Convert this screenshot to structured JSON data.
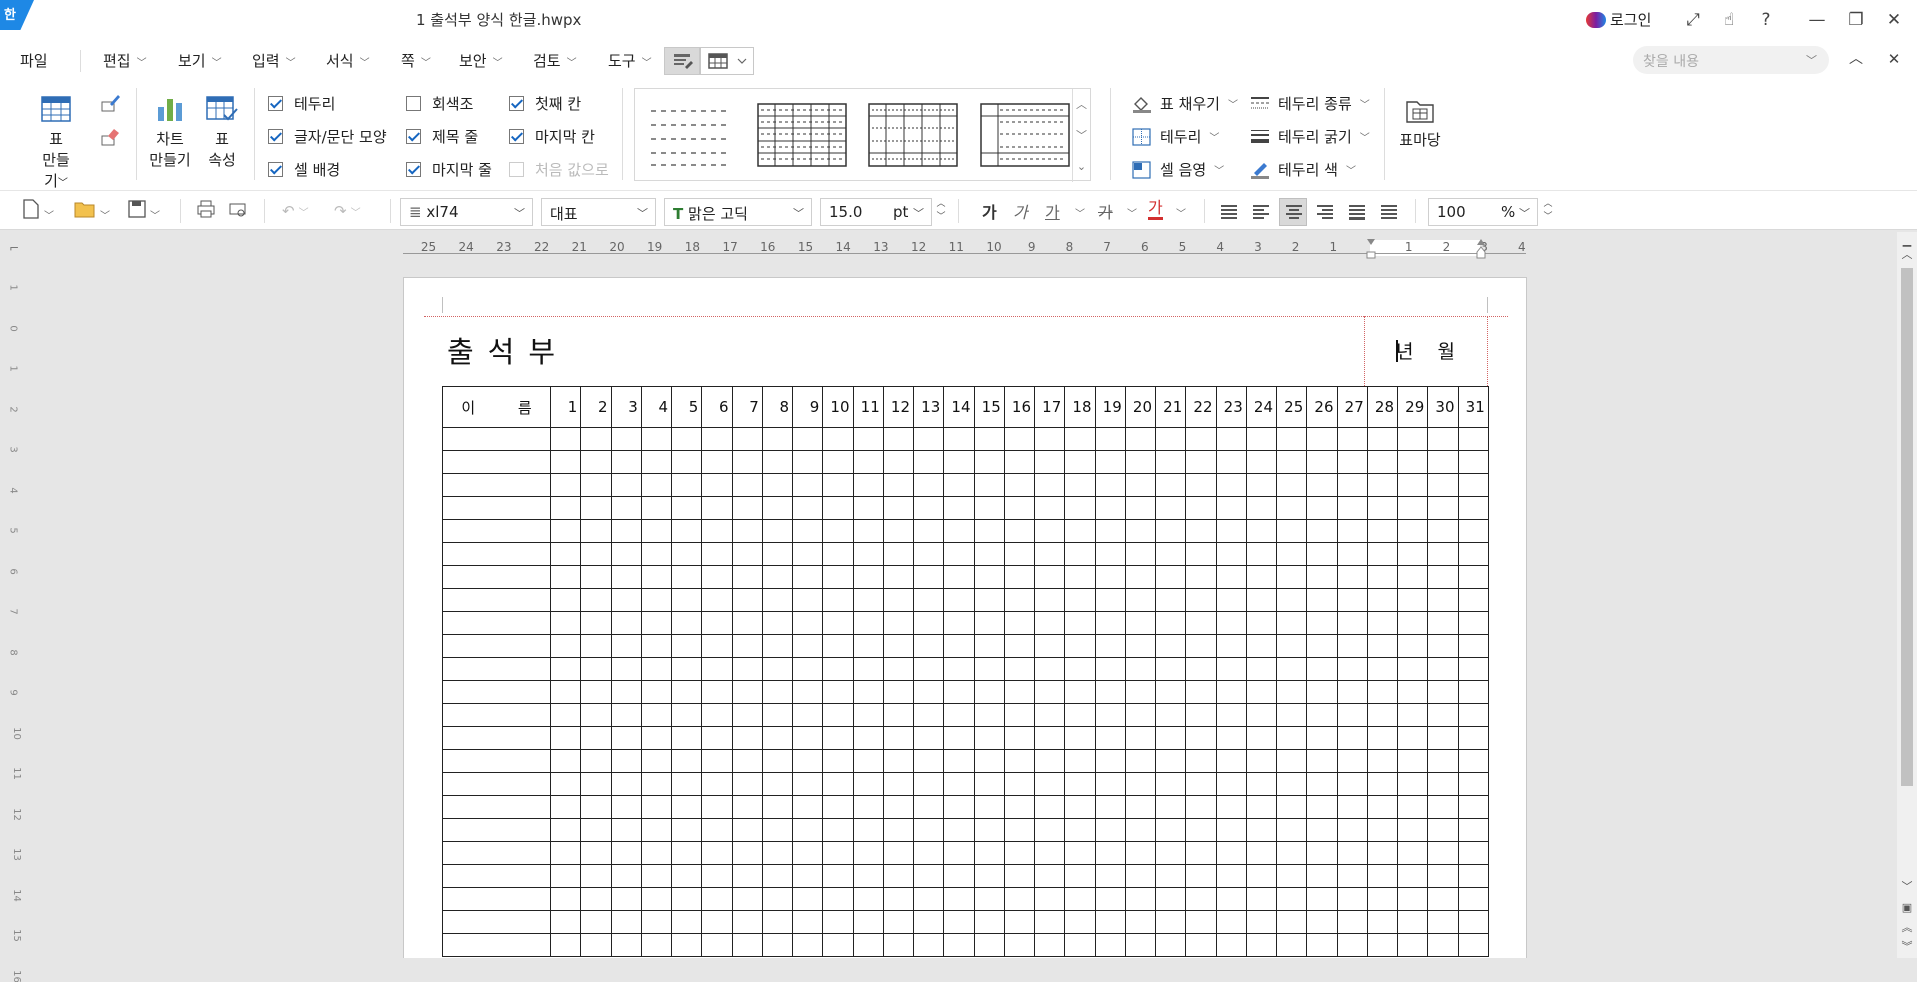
{
  "window": {
    "app_logo": "한",
    "title": "1 출석부 양식 한글.hwpx",
    "login_label": "로그인",
    "help_glyph": "?"
  },
  "menu": {
    "file": "파일",
    "items": [
      "편집",
      "보기",
      "입력",
      "서식",
      "쪽",
      "보안",
      "검토",
      "도구"
    ],
    "search_placeholder": "찾을 내용"
  },
  "ribbon": {
    "make_table": [
      "표",
      "만들기"
    ],
    "make_chart": [
      "차트",
      "만들기"
    ],
    "table_props": [
      "표",
      "속성"
    ],
    "checks": [
      {
        "label": "테두리",
        "checked": true,
        "enabled": true
      },
      {
        "label": "글자/문단 모양",
        "checked": true,
        "enabled": true
      },
      {
        "label": "셀 배경",
        "checked": true,
        "enabled": true
      },
      {
        "label": "회색조",
        "checked": false,
        "enabled": true
      },
      {
        "label": "제목 줄",
        "checked": true,
        "enabled": true
      },
      {
        "label": "마지막 줄",
        "checked": true,
        "enabled": true
      },
      {
        "label": "첫째 칸",
        "checked": true,
        "enabled": true
      },
      {
        "label": "마지막 칸",
        "checked": true,
        "enabled": true
      },
      {
        "label": "처음 값으로",
        "checked": false,
        "enabled": false
      }
    ],
    "fill": "표 채우기",
    "border": "테두리",
    "cell_shade": "셀 음영",
    "border_type": "테두리 종류",
    "border_width": "테두리 굵기",
    "border_color": "테두리 색",
    "table_madang": "표마당"
  },
  "toolbar": {
    "style_name": "xl74",
    "outline": "대표",
    "font": "맑은 고딕",
    "font_size": "15.0",
    "size_unit": "pt",
    "bold_glyph": "가",
    "italic_glyph": "가",
    "underline_glyph": "가",
    "strike_glyph": "가",
    "color_glyph": "가",
    "zoom": "100",
    "zoom_unit": "%",
    "accent_color": "#d32f2f"
  },
  "ruler": {
    "left_ticks": [
      "25",
      "24",
      "23",
      "22",
      "21",
      "20",
      "19",
      "18",
      "17",
      "16",
      "15",
      "14",
      "13",
      "12",
      "11",
      "10",
      "9",
      "8",
      "7",
      "6",
      "5",
      "4",
      "3",
      "2",
      "1"
    ],
    "right_ticks": [
      "1",
      "2",
      "3",
      "4"
    ],
    "vertical_ticks": [
      "1",
      "0",
      "1",
      "2",
      "3",
      "4",
      "5",
      "6",
      "7",
      "8",
      "9",
      "10",
      "11",
      "12",
      "13",
      "14",
      "15",
      "16"
    ]
  },
  "document": {
    "heading": "출석부",
    "month_label": "년 월",
    "name_header": "이 름",
    "days": [
      "1",
      "2",
      "3",
      "4",
      "5",
      "6",
      "7",
      "8",
      "9",
      "10",
      "11",
      "12",
      "13",
      "14",
      "15",
      "16",
      "17",
      "18",
      "19",
      "20",
      "21",
      "22",
      "23",
      "24",
      "25",
      "26",
      "27",
      "28",
      "29",
      "30",
      "31"
    ],
    "row_count": 23
  }
}
